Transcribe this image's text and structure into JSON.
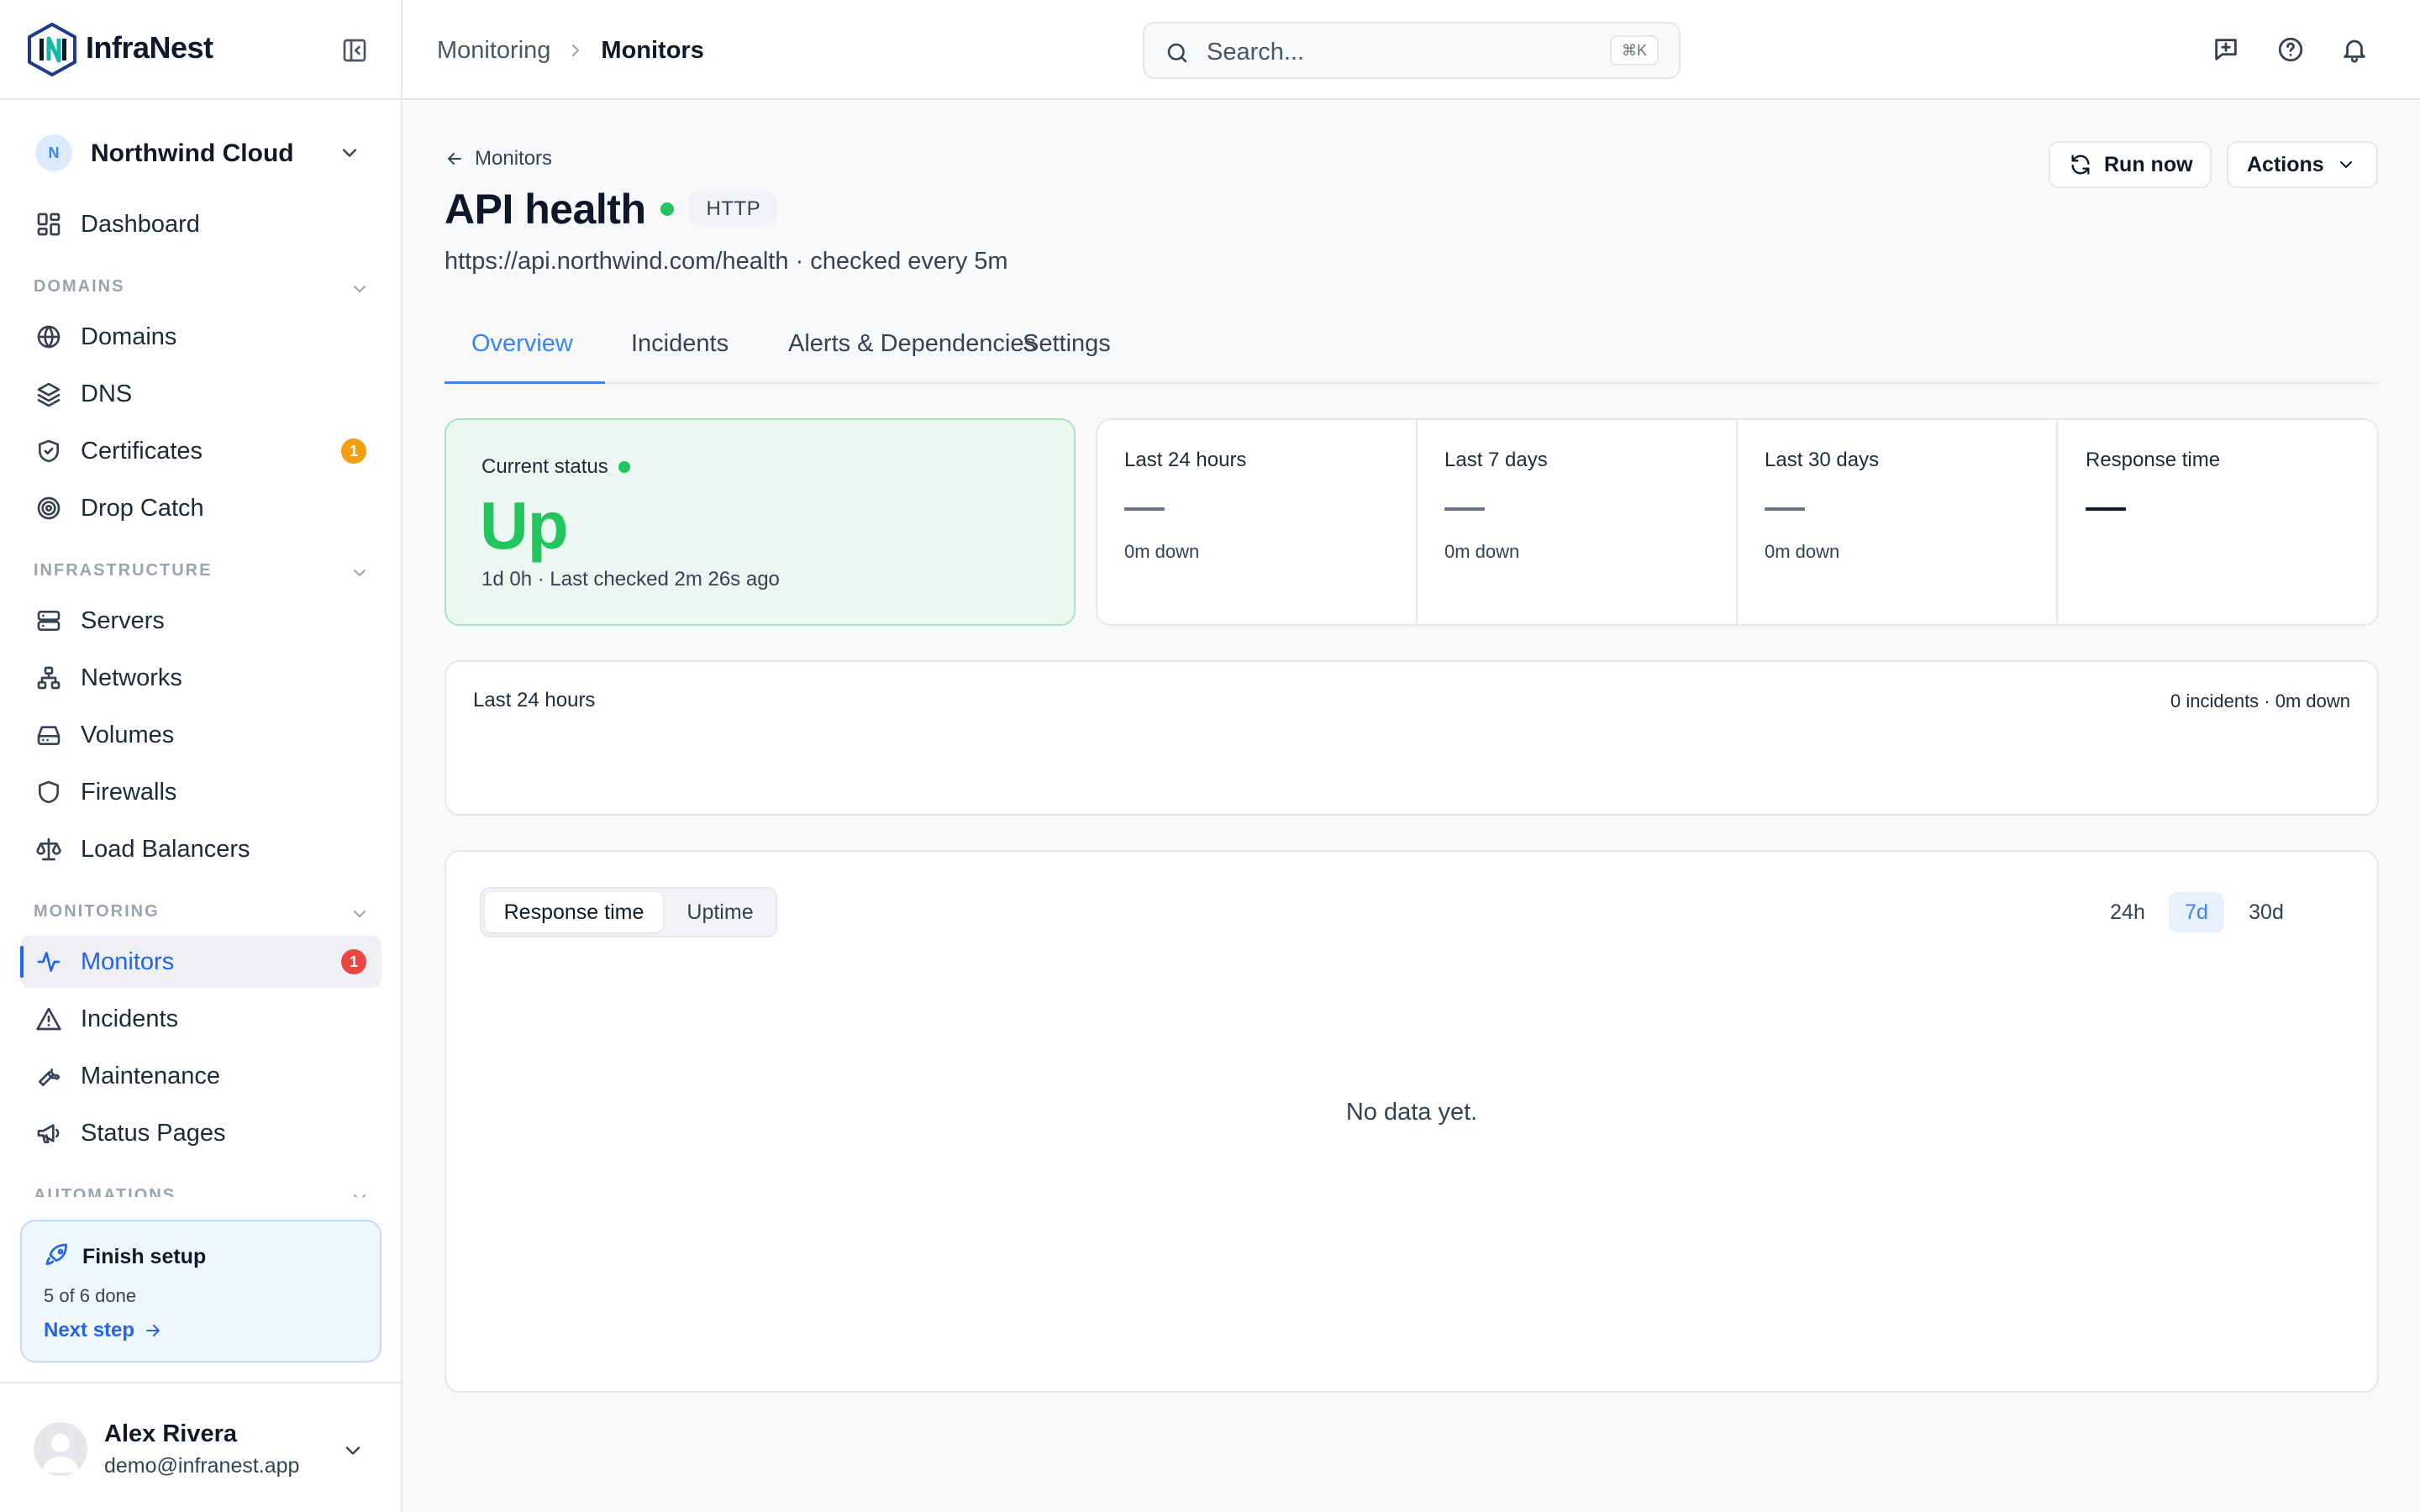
{
  "app": {
    "name": "InfraNest"
  },
  "org": {
    "initial": "N",
    "name": "Northwind Cloud"
  },
  "sidebar": {
    "dashboard": "Dashboard",
    "sections": {
      "domains": "DOMAINS",
      "infrastructure": "INFRASTRUCTURE",
      "monitoring": "MONITORING",
      "automations": "AUTOMATIONS"
    },
    "items": {
      "domains": "Domains",
      "dns": "DNS",
      "certificates": "Certificates",
      "certificates_badge": "1",
      "drop_catch": "Drop Catch",
      "servers": "Servers",
      "networks": "Networks",
      "volumes": "Volumes",
      "firewalls": "Firewalls",
      "load_balancers": "Load Balancers",
      "monitors": "Monitors",
      "monitors_badge": "1",
      "incidents": "Incidents",
      "maintenance": "Maintenance",
      "status_pages": "Status Pages"
    },
    "active_item": "Monitors",
    "setup": {
      "title": "Finish setup",
      "progress": "5 of 6 done",
      "next": "Next step"
    }
  },
  "user": {
    "name": "Alex Rivera",
    "email": "demo@infranest.app"
  },
  "topbar": {
    "breadcrumb": {
      "parent": "Monitoring",
      "current": "Monitors"
    },
    "search": {
      "placeholder": "Search...",
      "shortcut": "⌘K"
    }
  },
  "monitor": {
    "back_label": "Monitors",
    "name": "API health",
    "type": "HTTP",
    "subtitle": "https://api.northwind.com/health · checked every 5m",
    "run_now": "Run now",
    "actions": "Actions"
  },
  "tabs": [
    "Overview",
    "Incidents",
    "Alerts & Dependencies",
    "Settings"
  ],
  "active_tab": "Overview",
  "status": {
    "label": "Current status",
    "value": "Up",
    "meta": "1d 0h · Last checked 2m 26s ago",
    "color": "#22c55e"
  },
  "stats": [
    {
      "label": "Last 24 hours",
      "value": "—",
      "down": "0m down"
    },
    {
      "label": "Last 7 days",
      "value": "—",
      "down": "0m down"
    },
    {
      "label": "Last 30 days",
      "value": "—",
      "down": "0m down"
    },
    {
      "label": "Response time",
      "value": "—",
      "down": ""
    }
  ],
  "timeline": {
    "title": "Last 24 hours",
    "summary": "0 incidents · 0m down"
  },
  "chart": {
    "metrics": [
      "Response time",
      "Uptime"
    ],
    "active_metric": "Response time",
    "ranges": [
      "24h",
      "7d",
      "30d"
    ],
    "active_range": "7d",
    "empty_text": "No data yet."
  },
  "colors": {
    "accent": "#3b82f6",
    "up": "#22c55e",
    "alert": "#ef4444",
    "warning": "#f59e0b"
  }
}
